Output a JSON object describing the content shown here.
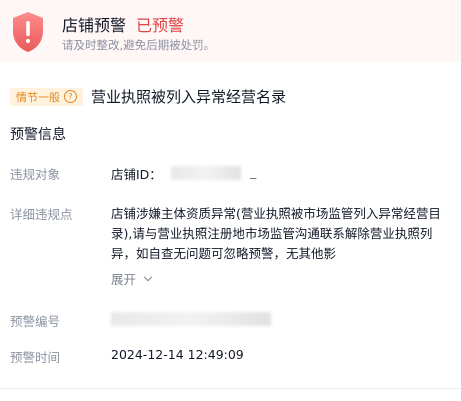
{
  "header": {
    "title": "店铺预警",
    "status": "已预警",
    "subtitle": "请及时整改,避免后期被处罚。",
    "icon": "shield-alert-icon",
    "colors": {
      "accent": "#e04444",
      "header_bg": "#fff6f6"
    }
  },
  "severity": {
    "label": "情节一般",
    "help_icon": "question-circle-icon",
    "color": "#e0861f"
  },
  "violation": {
    "title": "营业执照被列入异常经营名录"
  },
  "section": {
    "title": "预警信息"
  },
  "fields": {
    "target_label": "违规对象",
    "target_value_prefix": "店铺ID：",
    "target_value_tail": "_",
    "detail_label": "详细违规点",
    "detail_text": "店铺涉嫌主体资质异常(营业执照被市场监管列入异常经营目录),请与营业执照注册地市场监管沟通联系解除营业执照列异，如自查无问题可忽略预警，无其他影",
    "expand_label": "展开",
    "warning_no_label": "预警编号",
    "time_label": "预警时间",
    "time_value": "2024-12-14 12:49:09"
  }
}
